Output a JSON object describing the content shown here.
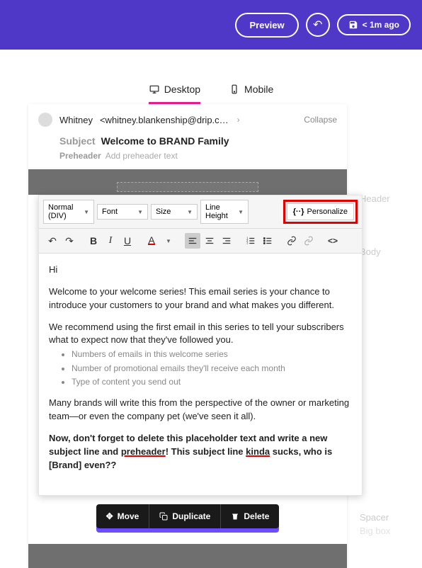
{
  "topbar": {
    "preview": "Preview",
    "saved_ago": "< 1m ago"
  },
  "tabs": {
    "desktop": "Desktop",
    "mobile": "Mobile"
  },
  "sender": {
    "name": "Whitney",
    "email": "<whitney.blankenship@drip.c…",
    "collapse": "Collapse"
  },
  "subject": {
    "label": "Subject",
    "value": "Welcome to BRAND Family"
  },
  "preheader": {
    "label": "Preheader",
    "value": "Add preheader text"
  },
  "editor_toolbar": {
    "normal": "Normal (DIV)",
    "font": "Font",
    "size": "Size",
    "line_height": "Line Height",
    "personalize": "Personalize"
  },
  "body": {
    "greeting": "Hi",
    "p1": "Welcome to your welcome series! This email series is your chance to introduce your customers to your brand and what makes you different.",
    "p2": "We recommend using the first email in this series to tell your subscribers what to expect now that they've followed you.",
    "bullets": [
      "Numbers of emails in this welcome series",
      "Number of promotional emails they'll receive each month",
      "Type of content you send out"
    ],
    "p3": "Many brands will write this from the perspective of the owner or marketing team—or even the company pet (we've seen it all).",
    "p4_a": "Now, don't forget to delete this placeholder text and write a new subject line and ",
    "p4_u1": "preheader",
    "p4_b": "! This subject line ",
    "p4_u2": "kinda",
    "p4_c": " sucks, who is [Brand] even??"
  },
  "actions": {
    "move": "Move",
    "duplicate": "Duplicate",
    "delete": "Delete"
  },
  "side": {
    "header": "Header",
    "body": "Body",
    "spacer": "Spacer",
    "bigbox": "Big box"
  }
}
